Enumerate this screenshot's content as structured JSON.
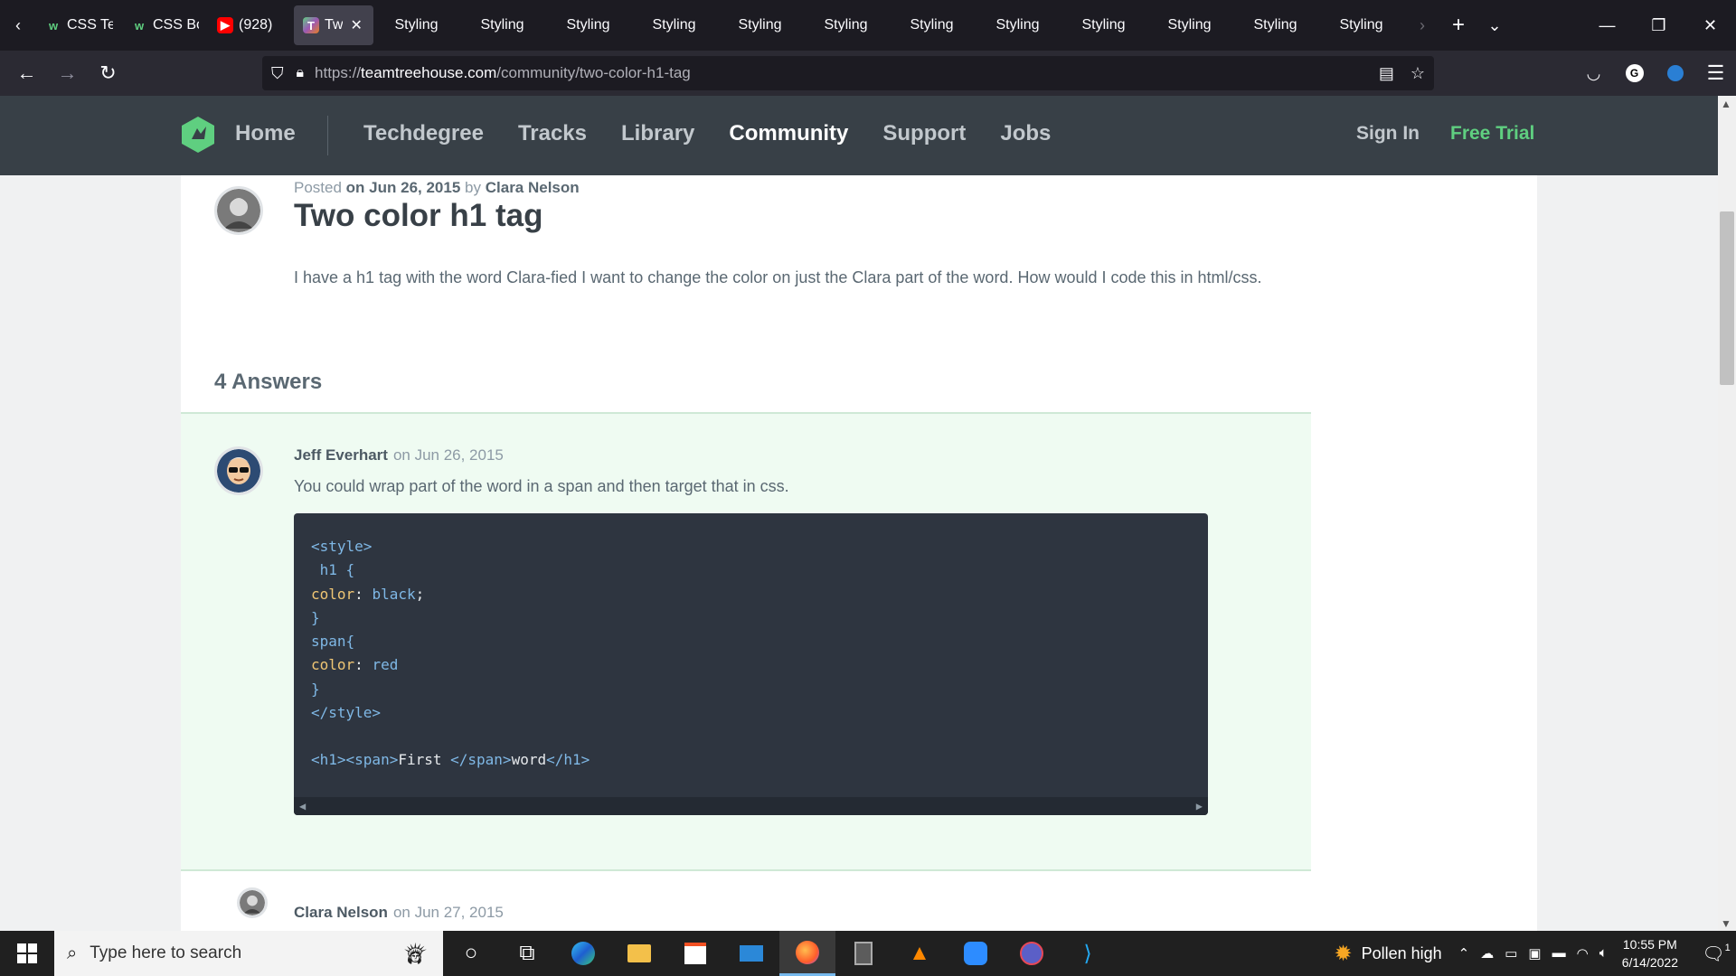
{
  "browser": {
    "tabs": [
      {
        "title": "CSS Te",
        "favicon": "w",
        "favicon_type": "w"
      },
      {
        "title": "CSS Bo",
        "favicon": "w",
        "favicon_type": "w"
      },
      {
        "title": "(928)",
        "favicon": "▶",
        "favicon_type": "yt"
      },
      {
        "title": "Tw",
        "favicon": "T",
        "favicon_type": "th",
        "active": true,
        "close": "✕"
      },
      {
        "title": "Styling"
      },
      {
        "title": "Styling"
      },
      {
        "title": "Styling"
      },
      {
        "title": "Styling"
      },
      {
        "title": "Styling"
      },
      {
        "title": "Styling"
      },
      {
        "title": "Styling"
      },
      {
        "title": "Styling"
      },
      {
        "title": "Styling"
      },
      {
        "title": "Styling"
      },
      {
        "title": "Styling"
      },
      {
        "title": "Styling"
      }
    ],
    "url_prefix": "https://",
    "url_host": "teamtreehouse.com",
    "url_path": "/community/two-color-h1-tag"
  },
  "site": {
    "nav": {
      "home": "Home",
      "links": [
        "Techdegree",
        "Tracks",
        "Library",
        "Community",
        "Support",
        "Jobs"
      ],
      "active": "Community",
      "sign_in": "Sign In",
      "free_trial": "Free Trial"
    },
    "post": {
      "meta_prefix": "Posted",
      "meta_date": "on Jun 26, 2015",
      "meta_by": "by",
      "author": "Clara Nelson",
      "title": "Two color h1 tag",
      "body": "I have a h1 tag with the word Clara-fied I want to change the color on just the Clara part of the word. How would I code this in html/css."
    },
    "answers_heading": "4 Answers",
    "answer": {
      "author": "Jeff Everhart",
      "date": "on Jun 26, 2015",
      "text": "You could wrap part of the word in a span and then target that in css.",
      "code_lines": [
        [
          {
            "t": "<style>",
            "c": "tag"
          }
        ],
        [
          {
            "t": " h1 {",
            "c": "tag"
          }
        ],
        [
          {
            "t": "color",
            "c": "prop"
          },
          {
            "t": ": ",
            "c": "kw"
          },
          {
            "t": "black",
            "c": "val"
          },
          {
            "t": ";",
            "c": "kw"
          }
        ],
        [
          {
            "t": "}",
            "c": "tag"
          }
        ],
        [
          {
            "t": "span{",
            "c": "tag"
          }
        ],
        [
          {
            "t": "color",
            "c": "prop"
          },
          {
            "t": ": ",
            "c": "kw"
          },
          {
            "t": "red",
            "c": "val"
          }
        ],
        [
          {
            "t": "}",
            "c": "tag"
          }
        ],
        [
          {
            "t": "</style>",
            "c": "tag"
          }
        ],
        [
          {
            "t": "",
            "c": "kw"
          }
        ],
        [
          {
            "t": "<h1><span>",
            "c": "tag"
          },
          {
            "t": "First ",
            "c": "kw"
          },
          {
            "t": "</span>",
            "c": "tag"
          },
          {
            "t": "word",
            "c": "kw"
          },
          {
            "t": "</h1>",
            "c": "tag"
          }
        ]
      ]
    },
    "reply": {
      "author": "Clara Nelson",
      "date": "on Jun 27, 2015"
    }
  },
  "taskbar": {
    "search_placeholder": "Type here to search",
    "weather": "Pollen high",
    "time": "10:55 PM",
    "date": "6/14/2022",
    "notifications": "1"
  },
  "colors": {
    "accent_green": "#5fcf80",
    "header_bg": "#384047",
    "answer_bg": "#effbf2",
    "code_bg": "#2e3540"
  }
}
